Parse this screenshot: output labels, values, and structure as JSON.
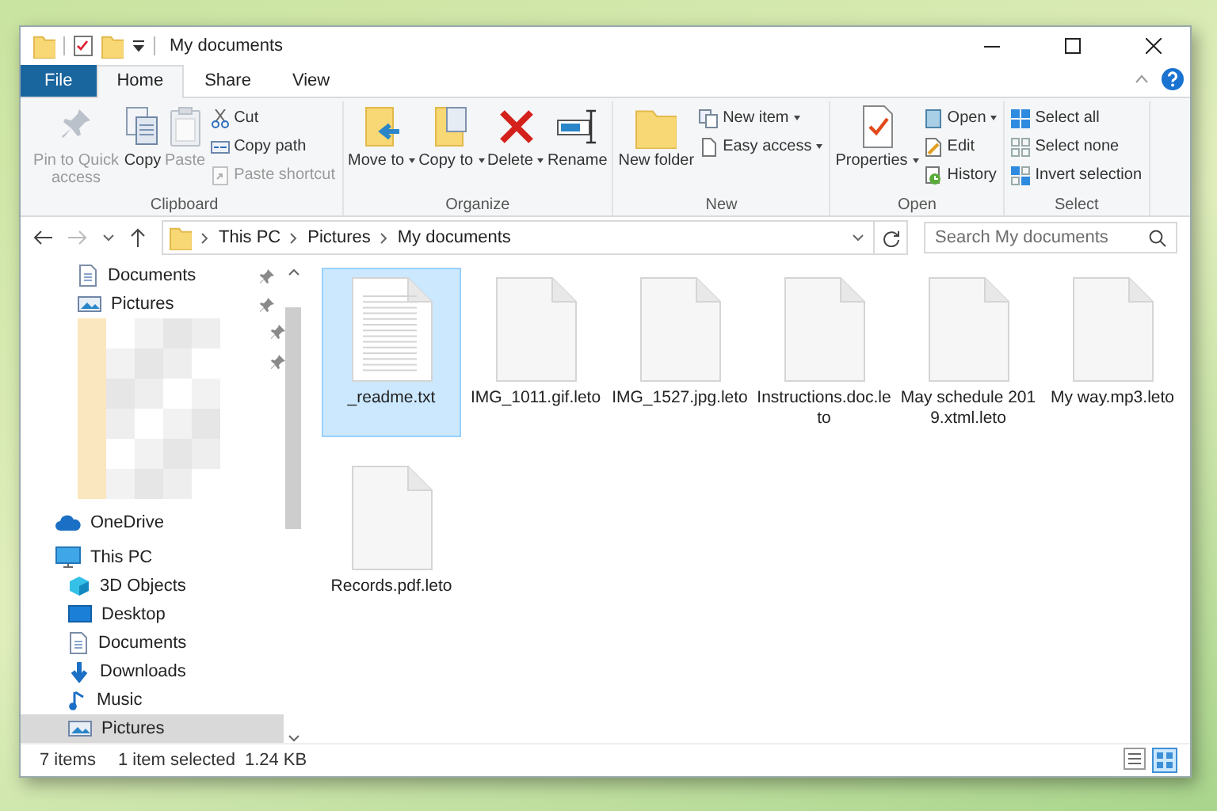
{
  "window": {
    "title": "My documents"
  },
  "tabs": [
    {
      "label": "File",
      "kind": "file",
      "selected": false
    },
    {
      "label": "Home",
      "kind": "tab",
      "selected": true
    },
    {
      "label": "Share",
      "kind": "tab",
      "selected": false
    },
    {
      "label": "View",
      "kind": "tab",
      "selected": false
    }
  ],
  "ribbon": [
    {
      "label": "Clipboard",
      "commands": [
        {
          "label": "Pin to Quick access",
          "kind": "large",
          "disabled": true,
          "dropdown": false
        },
        {
          "label": "Copy",
          "kind": "large",
          "disabled": false,
          "dropdown": false
        },
        {
          "label": "Paste",
          "kind": "large",
          "disabled": true,
          "dropdown": false
        },
        {
          "label": "Cut",
          "kind": "small",
          "disabled": false,
          "dropdown": false
        },
        {
          "label": "Copy path",
          "kind": "small",
          "disabled": false,
          "dropdown": false
        },
        {
          "label": "Paste shortcut",
          "kind": "small",
          "disabled": true,
          "dropdown": false
        }
      ]
    },
    {
      "label": "Organize",
      "commands": [
        {
          "label": "Move to",
          "kind": "large",
          "disabled": false,
          "dropdown": true
        },
        {
          "label": "Copy to",
          "kind": "large",
          "disabled": false,
          "dropdown": true
        },
        {
          "label": "Delete",
          "kind": "large",
          "disabled": false,
          "dropdown": true
        },
        {
          "label": "Rename",
          "kind": "large",
          "disabled": false,
          "dropdown": false
        }
      ]
    },
    {
      "label": "New",
      "commands": [
        {
          "label": "New folder",
          "kind": "large",
          "disabled": false,
          "dropdown": false
        },
        {
          "label": "New item",
          "kind": "small",
          "disabled": false,
          "dropdown": true
        },
        {
          "label": "Easy access",
          "kind": "small",
          "disabled": false,
          "dropdown": true
        }
      ]
    },
    {
      "label": "Open",
      "commands": [
        {
          "label": "Properties",
          "kind": "large",
          "disabled": false,
          "dropdown": true
        },
        {
          "label": "Open",
          "kind": "small",
          "disabled": false,
          "dropdown": true
        },
        {
          "label": "Edit",
          "kind": "small",
          "disabled": false,
          "dropdown": false
        },
        {
          "label": "History",
          "kind": "small",
          "disabled": false,
          "dropdown": false
        }
      ]
    },
    {
      "label": "Select",
      "commands": [
        {
          "label": "Select all",
          "kind": "small",
          "disabled": false,
          "dropdown": false
        },
        {
          "label": "Select none",
          "kind": "small",
          "disabled": false,
          "dropdown": false
        },
        {
          "label": "Invert selection",
          "kind": "small",
          "disabled": false,
          "dropdown": false
        }
      ]
    }
  ],
  "address": {
    "breadcrumbs": [
      "This PC",
      "Pictures",
      "My documents"
    ]
  },
  "search": {
    "placeholder": "Search My documents"
  },
  "sidebar": {
    "items": [
      {
        "label": "Documents",
        "kind": "documents",
        "pinned": true,
        "selected": false
      },
      {
        "label": "Pictures",
        "kind": "pictures",
        "pinned": true,
        "selected": false
      },
      {
        "kind": "blurred",
        "pinned": true,
        "selected": false
      },
      {
        "label": "OneDrive",
        "kind": "onedrive",
        "pinned": false,
        "selected": false
      },
      {
        "label": "This PC",
        "kind": "pc",
        "pinned": false,
        "selected": false,
        "children": [
          {
            "label": "3D Objects",
            "kind": "objects3d",
            "pinned": false,
            "selected": false
          },
          {
            "label": "Desktop",
            "kind": "desktop",
            "pinned": false,
            "selected": false
          },
          {
            "label": "Documents",
            "kind": "documents",
            "pinned": false,
            "selected": false
          },
          {
            "label": "Downloads",
            "kind": "downloads",
            "pinned": false,
            "selected": false
          },
          {
            "label": "Music",
            "kind": "music",
            "pinned": false,
            "selected": false
          },
          {
            "label": "Pictures",
            "kind": "pictures",
            "pinned": false,
            "selected": true
          }
        ]
      }
    ]
  },
  "files": [
    {
      "name": "_readme.txt",
      "kind": "text",
      "selected": true
    },
    {
      "name": "IMG_1011.gif.leto",
      "kind": "blank",
      "selected": false
    },
    {
      "name": "IMG_1527.jpg.leto",
      "kind": "blank",
      "selected": false
    },
    {
      "name": "Instructions.doc.leto",
      "kind": "blank",
      "selected": false
    },
    {
      "name": "May schedule 2019.xtml.leto",
      "kind": "blank",
      "selected": false
    },
    {
      "name": "My way.mp3.leto",
      "kind": "blank",
      "selected": false
    },
    {
      "name": "Records.pdf.leto",
      "kind": "blank",
      "selected": false
    }
  ],
  "status_bar": {
    "item_count": "7 items",
    "selection": "1 item selected",
    "size": "1.24 KB"
  }
}
